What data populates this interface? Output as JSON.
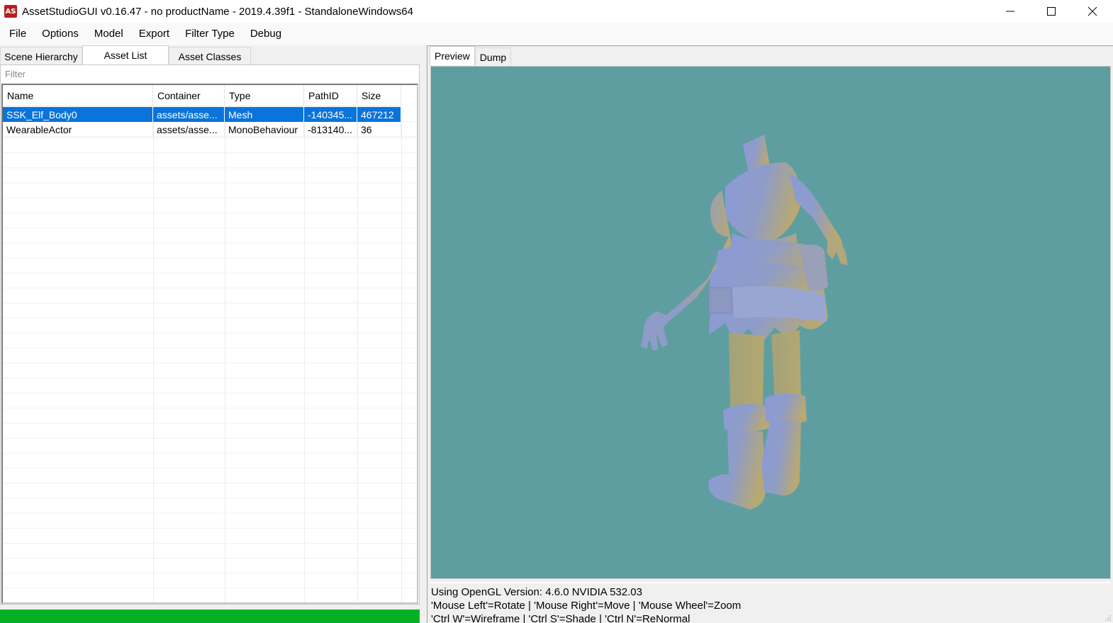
{
  "window": {
    "icon_text": "AS",
    "title": "AssetStudioGUI v0.16.47 - no productName - 2019.4.39f1 - StandaloneWindows64"
  },
  "menu": [
    "File",
    "Options",
    "Model",
    "Export",
    "Filter Type",
    "Debug"
  ],
  "left_tabs": [
    {
      "label": "Scene Hierarchy",
      "active": false
    },
    {
      "label": "Asset List",
      "active": true
    },
    {
      "label": "Asset Classes",
      "active": false
    }
  ],
  "filter": {
    "placeholder": "Filter"
  },
  "asset_list": {
    "columns": [
      "Name",
      "Container",
      "Type",
      "PathID",
      "Size"
    ],
    "rows": [
      {
        "name": "SSK_Elf_Body0",
        "container": "assets/asse...",
        "type": "Mesh",
        "path_id": "-140345...",
        "size": "467212",
        "selected": true
      },
      {
        "name": "WearableActor",
        "container": "assets/asse...",
        "type": "MonoBehaviour",
        "path_id": "-813140...",
        "size": "36",
        "selected": false
      }
    ]
  },
  "right_tabs": [
    {
      "label": "Preview",
      "active": true
    },
    {
      "label": "Dump",
      "active": false
    }
  ],
  "preview": {
    "background": "#5f9ea0",
    "info_lines": [
      "Using OpenGL Version: 4.6.0 NVIDIA 532.03",
      "'Mouse Left'=Rotate | 'Mouse Right'=Move | 'Mouse Wheel'=Zoom",
      "'Ctrl W'=Wireframe | 'Ctrl S'=Shade | 'Ctrl N'=ReNormal"
    ]
  },
  "colors": {
    "selection": "#0a74da",
    "progress": "#06b025",
    "app_icon": "#b81e1e"
  }
}
